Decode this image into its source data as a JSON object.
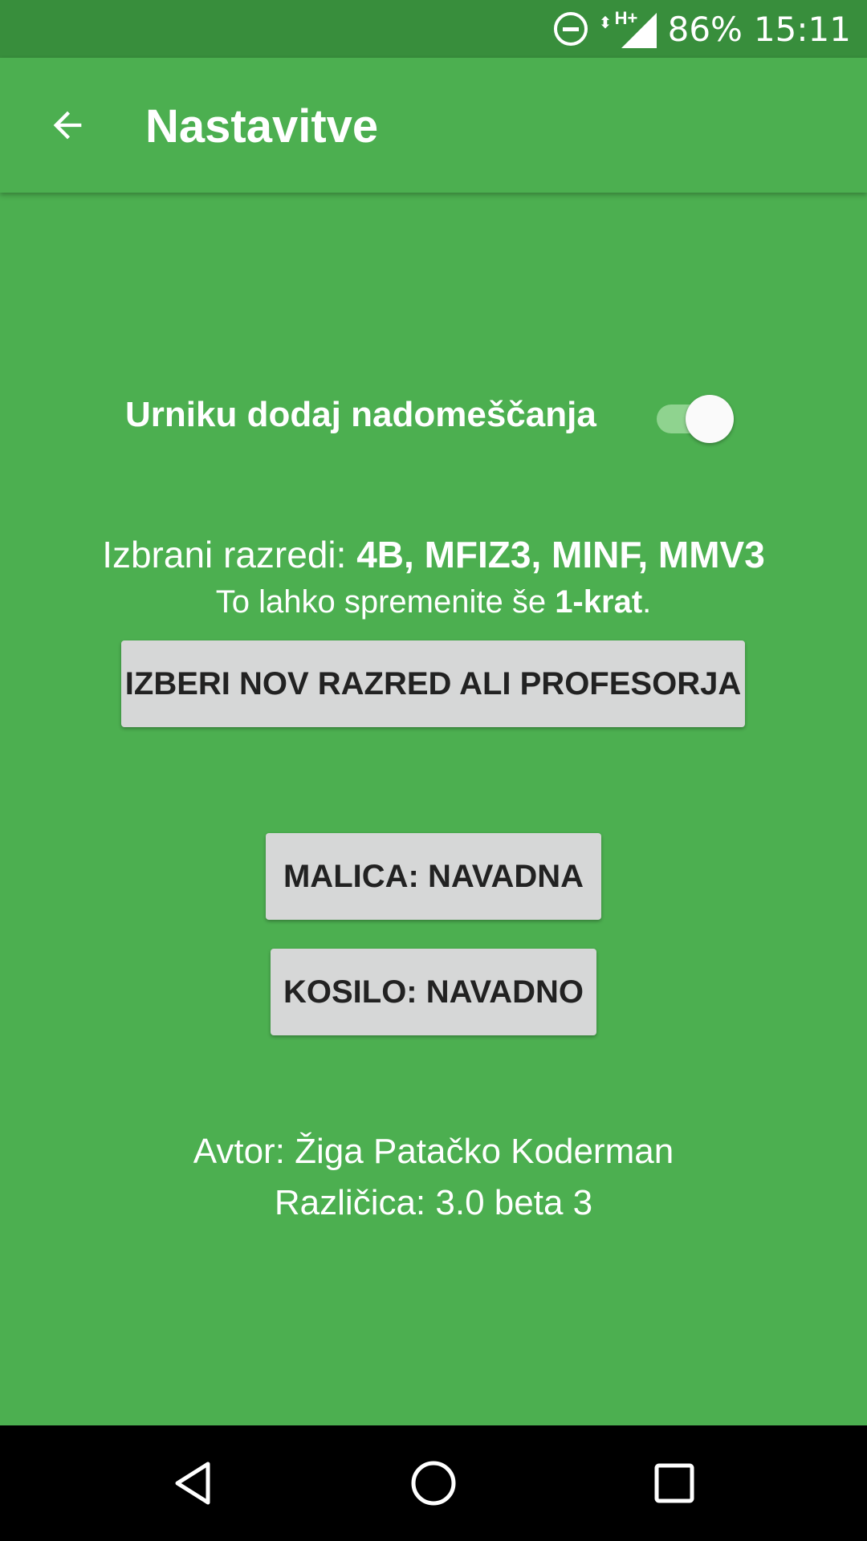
{
  "status_bar": {
    "battery": "86%",
    "time": "15:11",
    "network_type": "H+",
    "icons": [
      "do-not-disturb-icon",
      "network-activity-icon",
      "signal-icon"
    ]
  },
  "app_bar": {
    "title": "Nastavitve",
    "back_icon": "arrow-back-icon"
  },
  "settings": {
    "toggle_label": "Urniku dodaj nadomeščanja",
    "toggle_on": true,
    "classes_prefix": "Izbrani razredi: ",
    "classes_value": "4B, MFIZ3, MINF, MMV3",
    "change_prefix": "To lahko spremenite še ",
    "change_value": "1-krat",
    "change_suffix": ".",
    "choose_button": "IZBERI NOV RAZRED ALI PROFESORJA",
    "malica_button": "MALICA: NAVADNA",
    "kosilo_button": "KOSILO: NAVADNO",
    "author": "Avtor: Žiga Patačko Koderman",
    "version": "Različica: 3.0 beta 3"
  },
  "nav_bar": {
    "icons": [
      "nav-back-icon",
      "nav-home-icon",
      "nav-recent-icon"
    ]
  },
  "colors": {
    "primary": "#4caf50",
    "primary_dark": "#388e3c",
    "button_bg": "#d6d7d7",
    "toggle_track": "#8fd38f"
  }
}
